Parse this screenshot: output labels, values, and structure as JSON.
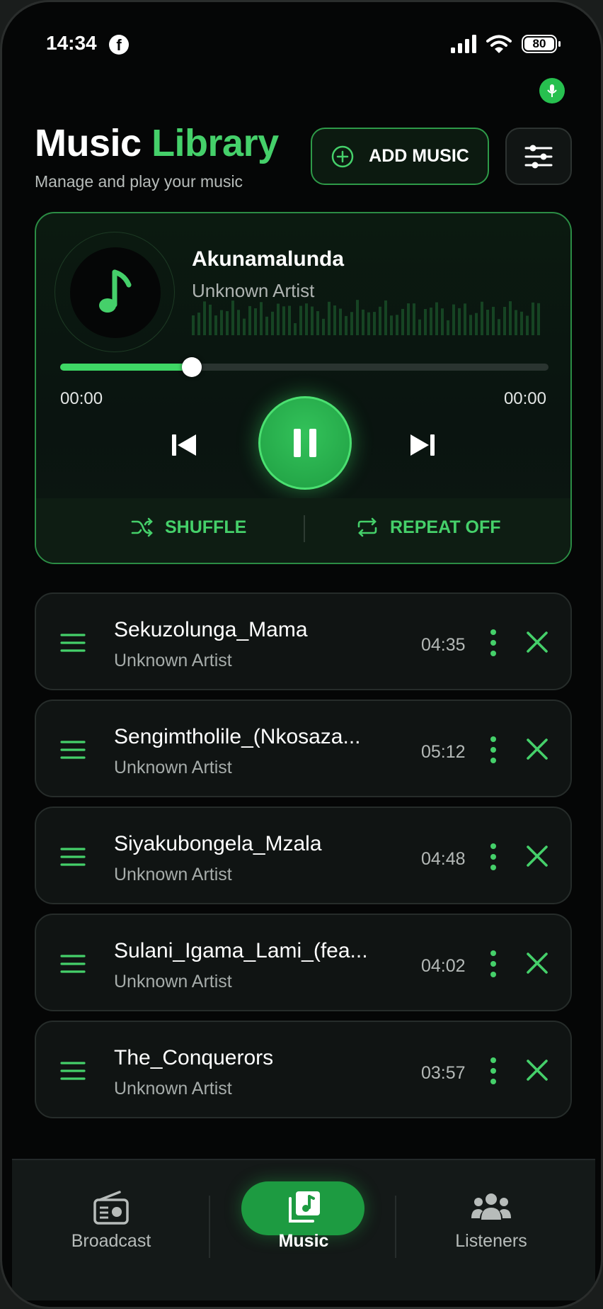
{
  "status_bar": {
    "time": "14:34",
    "battery": "80"
  },
  "header": {
    "title_main": "Music",
    "title_accent": "Library",
    "subtitle": "Manage and play your music",
    "add_music_label": "ADD MUSIC"
  },
  "player": {
    "title": "Akunamalunda",
    "artist": "Unknown Artist",
    "elapsed": "00:00",
    "total": "00:00",
    "progress": 0.27,
    "shuffle_label": "SHUFFLE",
    "repeat_label": "REPEAT OFF"
  },
  "tracks": [
    {
      "name": "Sekuzolunga_Mama",
      "artist": "Unknown Artist",
      "duration": "04:35"
    },
    {
      "name": "Sengimtholile_(Nkosaza...",
      "artist": "Unknown Artist",
      "duration": "05:12"
    },
    {
      "name": "Siyakubongela_Mzala",
      "artist": "Unknown Artist",
      "duration": "04:48"
    },
    {
      "name": "Sulani_Igama_Lami_(fea...",
      "artist": "Unknown Artist",
      "duration": "04:02"
    },
    {
      "name": "The_Conquerors",
      "artist": "Unknown Artist",
      "duration": "03:57"
    }
  ],
  "nav": [
    {
      "label": "Broadcast",
      "icon": "radio-icon"
    },
    {
      "label": "Music",
      "icon": "music-library-icon",
      "active": true
    },
    {
      "label": "Listeners",
      "icon": "group-icon"
    }
  ],
  "colors": {
    "accent": "#45d06a",
    "background": "#050606",
    "card": "#101413"
  }
}
